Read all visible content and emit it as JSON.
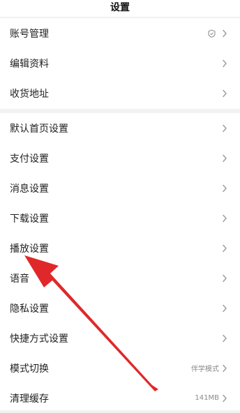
{
  "header": {
    "title": "设置"
  },
  "group1": [
    {
      "label": "账号管理",
      "has_badge_icon": true
    },
    {
      "label": "编辑资料"
    },
    {
      "label": "收货地址"
    }
  ],
  "group2": [
    {
      "label": "默认首页设置"
    },
    {
      "label": "支付设置"
    },
    {
      "label": "消息设置"
    },
    {
      "label": "下载设置"
    },
    {
      "label": "播放设置"
    },
    {
      "label": "语音"
    },
    {
      "label": "隐私设置"
    },
    {
      "label": "快捷方式设置"
    },
    {
      "label": "模式切换",
      "value": "伴学模式"
    },
    {
      "label": "清理缓存",
      "value": "141MB"
    }
  ],
  "colors": {
    "arrow": "#e0282a",
    "chevron": "#9a9a9a"
  }
}
